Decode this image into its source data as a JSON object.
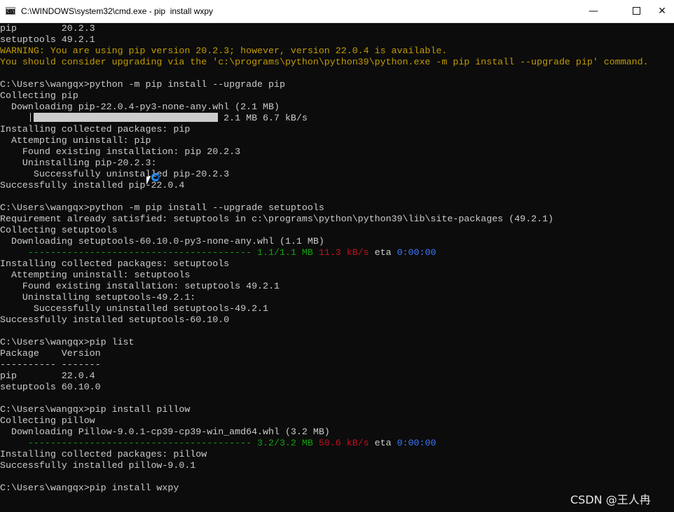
{
  "window": {
    "title": "C:\\WINDOWS\\system32\\cmd.exe - pip  install wxpy",
    "icon": "cmd-icon",
    "buttons": {
      "minimize": "—",
      "maximize": "max-box",
      "close": "✕"
    }
  },
  "console": {
    "lines": [
      {
        "segments": [
          {
            "text": "pip        20.2.3"
          }
        ]
      },
      {
        "segments": [
          {
            "text": "setuptools 49.2.1"
          }
        ]
      },
      {
        "segments": [
          {
            "text": "WARNING: You are using pip version 20.2.3; however, version 22.0.4 is available.",
            "color": "#c19c00"
          }
        ]
      },
      {
        "segments": [
          {
            "text": "You should consider upgrading via the 'c:\\programs\\python\\python39\\python.exe -m pip install --upgrade pip' command.",
            "color": "#c19c00"
          }
        ]
      },
      {
        "segments": [
          {
            "text": ""
          }
        ]
      },
      {
        "segments": [
          {
            "text": "C:\\Users\\wangqx>python -m pip install --upgrade pip"
          }
        ]
      },
      {
        "segments": [
          {
            "text": "Collecting pip"
          }
        ]
      },
      {
        "segments": [
          {
            "text": "  Downloading pip-22.0.4-py3-none-any.whl (2.1 MB)"
          }
        ]
      },
      {
        "segments": [
          {
            "text": "                                        2.1 MB 6.7 kB/s"
          }
        ]
      },
      {
        "segments": [
          {
            "text": "Installing collected packages: pip"
          }
        ]
      },
      {
        "segments": [
          {
            "text": "  Attempting uninstall: pip"
          }
        ]
      },
      {
        "segments": [
          {
            "text": "    Found existing installation: pip 20.2.3"
          }
        ]
      },
      {
        "segments": [
          {
            "text": "    Uninstalling pip-20.2.3:"
          }
        ]
      },
      {
        "segments": [
          {
            "text": "      Successfully uninstalled pip-20.2.3"
          }
        ]
      },
      {
        "segments": [
          {
            "text": "Successfully installed pip-22.0.4"
          }
        ]
      },
      {
        "segments": [
          {
            "text": ""
          }
        ]
      },
      {
        "segments": [
          {
            "text": "C:\\Users\\wangqx>python -m pip install --upgrade setuptools"
          }
        ]
      },
      {
        "segments": [
          {
            "text": "Requirement already satisfied: setuptools in c:\\programs\\python\\python39\\lib\\site-packages (49.2.1)"
          }
        ]
      },
      {
        "segments": [
          {
            "text": "Collecting setuptools"
          }
        ]
      },
      {
        "segments": [
          {
            "text": "  Downloading setuptools-60.10.0-py3-none-any.whl (1.1 MB)"
          }
        ]
      },
      {
        "segments": [
          {
            "text": "     ---------------------------------------- 1.1/1.1 MB",
            "color": "#13a10e"
          },
          {
            "text": " 11.3 kB/s",
            "color": "#c50f1f"
          },
          {
            "text": " eta "
          },
          {
            "text": "0:00:00",
            "color": "#3b78ff"
          }
        ]
      },
      {
        "segments": [
          {
            "text": "Installing collected packages: setuptools"
          }
        ]
      },
      {
        "segments": [
          {
            "text": "  Attempting uninstall: setuptools"
          }
        ]
      },
      {
        "segments": [
          {
            "text": "    Found existing installation: setuptools 49.2.1"
          }
        ]
      },
      {
        "segments": [
          {
            "text": "    Uninstalling setuptools-49.2.1:"
          }
        ]
      },
      {
        "segments": [
          {
            "text": "      Successfully uninstalled setuptools-49.2.1"
          }
        ]
      },
      {
        "segments": [
          {
            "text": "Successfully installed setuptools-60.10.0"
          }
        ]
      },
      {
        "segments": [
          {
            "text": ""
          }
        ]
      },
      {
        "segments": [
          {
            "text": "C:\\Users\\wangqx>pip list"
          }
        ]
      },
      {
        "segments": [
          {
            "text": "Package    Version"
          }
        ]
      },
      {
        "segments": [
          {
            "text": "---------- -------"
          }
        ]
      },
      {
        "segments": [
          {
            "text": "pip        22.0.4"
          }
        ]
      },
      {
        "segments": [
          {
            "text": "setuptools 60.10.0"
          }
        ]
      },
      {
        "segments": [
          {
            "text": ""
          }
        ]
      },
      {
        "segments": [
          {
            "text": "C:\\Users\\wangqx>pip install pillow"
          }
        ]
      },
      {
        "segments": [
          {
            "text": "Collecting pillow"
          }
        ]
      },
      {
        "segments": [
          {
            "text": "  Downloading Pillow-9.0.1-cp39-cp39-win_amd64.whl (3.2 MB)"
          }
        ]
      },
      {
        "segments": [
          {
            "text": "     ---------------------------------------- 3.2/3.2 MB",
            "color": "#13a10e"
          },
          {
            "text": " 50.6 kB/s",
            "color": "#c50f1f"
          },
          {
            "text": " eta "
          },
          {
            "text": "0:00:00",
            "color": "#3b78ff"
          }
        ]
      },
      {
        "segments": [
          {
            "text": "Installing collected packages: pillow"
          }
        ]
      },
      {
        "segments": [
          {
            "text": "Successfully installed pillow-9.0.1"
          }
        ]
      },
      {
        "segments": [
          {
            "text": ""
          }
        ]
      },
      {
        "segments": [
          {
            "text": "C:\\Users\\wangqx>pip install wxpy"
          }
        ]
      }
    ],
    "pip_progress": 1.0,
    "cursor_icon": "mouse-pointer-icon",
    "busy_icon": "loading-spinner-icon"
  },
  "watermark": "CSDN @王人冉"
}
